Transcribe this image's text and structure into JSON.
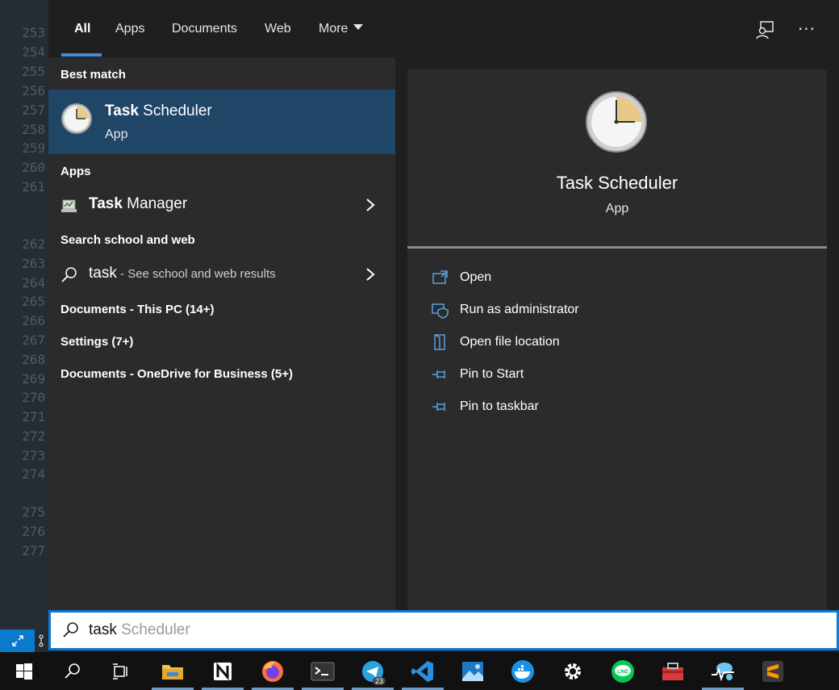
{
  "editor": {
    "line_numbers": [
      "253",
      "254",
      "255",
      "256",
      "257",
      "258",
      "259",
      "260",
      "261",
      "262",
      "263",
      "264",
      "265",
      "266",
      "267",
      "268",
      "269",
      "270",
      "271",
      "272",
      "273",
      "274",
      "275",
      "276",
      "277"
    ]
  },
  "tabs": [
    {
      "label": "All",
      "active": true
    },
    {
      "label": "Apps"
    },
    {
      "label": "Documents"
    },
    {
      "label": "Web"
    },
    {
      "label": "More"
    }
  ],
  "left": {
    "best_match_heading": "Best match",
    "best_match": {
      "title_bold": "Task",
      "title_rest": " Scheduler",
      "subtitle": "App"
    },
    "apps_heading": "Apps",
    "apps_item": {
      "bold": "Task",
      "rest": " Manager"
    },
    "search_web_heading": "Search school and web",
    "web_item": {
      "query": "task",
      "hint": " - See school and web results"
    },
    "docs_pc": "Documents - This PC (14+)",
    "settings": "Settings (7+)",
    "docs_onedrive": "Documents - OneDrive for Business (5+)"
  },
  "right": {
    "title": "Task Scheduler",
    "subtitle": "App",
    "actions": [
      {
        "label": "Open",
        "icon": "open-icon"
      },
      {
        "label": "Run as administrator",
        "icon": "shield-icon"
      },
      {
        "label": "Open file location",
        "icon": "file-location-icon"
      },
      {
        "label": "Pin to Start",
        "icon": "pin-icon"
      },
      {
        "label": "Pin to taskbar",
        "icon": "pin-icon"
      }
    ]
  },
  "search": {
    "typed": "task",
    "suggestion": " Scheduler"
  },
  "taskbar": {
    "telegram_badge": "23",
    "items": [
      "start-icon",
      "search-icon",
      "task-view-icon",
      "file-explorer-icon",
      "notion-icon",
      "firefox-icon",
      "terminal-icon",
      "telegram-icon",
      "vscode-icon",
      "photos-icon",
      "docker-icon",
      "settings-icon",
      "line-icon",
      "toolbox-icon",
      "azure-icon",
      "sublime-icon"
    ]
  },
  "colors": {
    "accent": "#0a78d4",
    "selected": "#1f4567"
  }
}
